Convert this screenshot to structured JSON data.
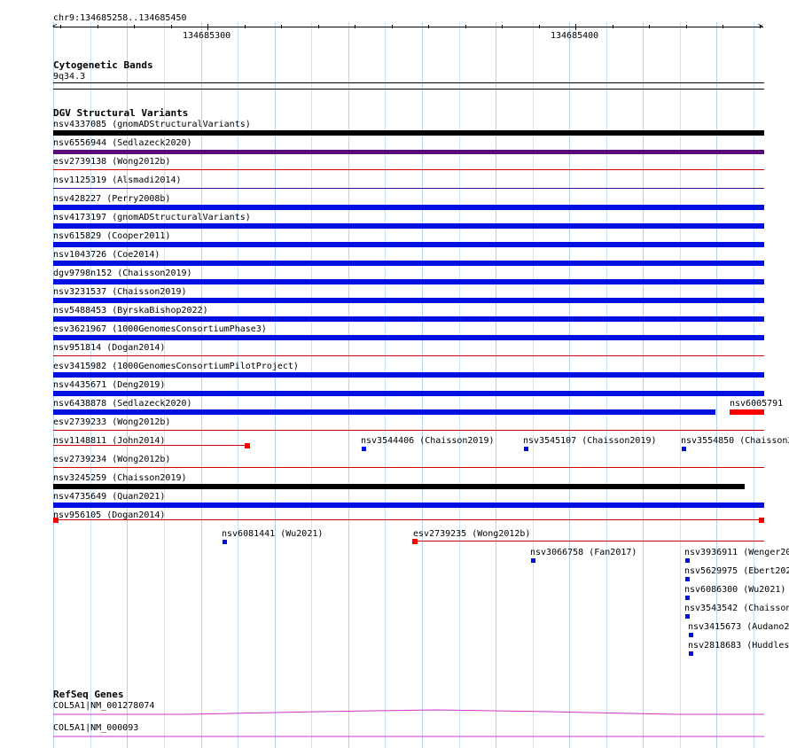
{
  "ruler": {
    "range_label": "chr9:134685258..134685450",
    "tick_labels": [
      "134685300",
      "134685400"
    ]
  },
  "cytoband": {
    "title": "Cytogenetic Bands",
    "band_label": "9q34.3"
  },
  "dgv": {
    "title": "DGV Structural Variants",
    "rows": [
      {
        "label": "nsv4337085 (gnomADStructuralVariants)",
        "color": "#000000",
        "kind": "thick"
      },
      {
        "label": "nsv6556944 (Sedlazeck2020)",
        "color": "#5a0a7a",
        "kind": "medium"
      },
      {
        "label": "esv2739138 (Wong2012b)",
        "color": "#d00000",
        "kind": "thin"
      },
      {
        "label": "nsv1125319 (Alsmadi2014)",
        "color": "#3a0a8a",
        "kind": "thin"
      },
      {
        "label": "nsv428227 (Perry2008b)",
        "color": "#0010e0",
        "kind": "thick"
      },
      {
        "label": "nsv4173197 (gnomADStructuralVariants)",
        "color": "#0010e0",
        "kind": "thick"
      },
      {
        "label": "nsv615829 (Cooper2011)",
        "color": "#0010e0",
        "kind": "thick"
      },
      {
        "label": "nsv1043726 (Coe2014)",
        "color": "#0010e0",
        "kind": "thick"
      },
      {
        "label": "dgv9798n152 (Chaisson2019)",
        "color": "#0010e0",
        "kind": "thick"
      },
      {
        "label": "nsv3231537 (Chaisson2019)",
        "color": "#0010e0",
        "kind": "thick"
      },
      {
        "label": "nsv5488453 (ByrskaBishop2022)",
        "color": "#0010e0",
        "kind": "thick"
      },
      {
        "label": "esv3621967 (1000GenomesConsortiumPhase3)",
        "color": "#0010e0",
        "kind": "thick"
      },
      {
        "label": "nsv951814 (Dogan2014)",
        "color": "#d00000",
        "kind": "thin"
      },
      {
        "label": "esv3415982 (1000GenomesConsortiumPilotProject)",
        "color": "#0010e0",
        "kind": "thick"
      },
      {
        "label": "nsv4435671 (Deng2019)",
        "color": "#0010e0",
        "kind": "thick"
      },
      {
        "label": "nsv6438878 (Sedlazeck2020)",
        "color": "#0010e0",
        "kind": "partial"
      },
      {
        "label": "esv2739233 (Wong2012b)",
        "color": "#d00000",
        "kind": "thin"
      },
      {
        "label": "nsv1148811 (John2014)",
        "color": "#d00000",
        "kind": "short-thin"
      },
      {
        "label": "esv2739234 (Wong2012b)",
        "color": "#d00000",
        "kind": "thin"
      },
      {
        "label": "nsv3245259 (Chaisson2019)",
        "color": "#000000",
        "kind": "thick-partial"
      },
      {
        "label": "nsv4735649 (Quan2021)",
        "color": "#0010e0",
        "kind": "thick"
      },
      {
        "label": "nsv956105 (Dogan2014)",
        "color": "#d00000",
        "kind": "thin-ends"
      }
    ],
    "side_label": "nsv6005791",
    "extra_features": [
      {
        "label": "nsv3544406 (Chaisson2019)",
        "color": "#0010e0"
      },
      {
        "label": "nsv3545107 (Chaisson2019)",
        "color": "#0010e0"
      },
      {
        "label": "nsv3554850 (Chaisson2",
        "color": "#0010e0"
      },
      {
        "label": "nsv6081441 (Wu2021)",
        "color": "#0010e0"
      },
      {
        "label": "esv2739235 (Wong2012b)",
        "color": "#d00000"
      },
      {
        "label": "nsv3066758 (Fan2017)",
        "color": "#0010e0"
      },
      {
        "label": "nsv3936911 (Wenger20",
        "color": "#0010e0"
      },
      {
        "label": "nsv5629975 (Ebert202",
        "color": "#0010e0"
      },
      {
        "label": "nsv6086300 (Wu2021)",
        "color": "#0010e0"
      },
      {
        "label": "nsv3543542 (Chaisson",
        "color": "#0010e0"
      },
      {
        "label": "nsv3415673 (Audano2",
        "color": "#0010e0"
      },
      {
        "label": "nsv2818683 (Huddles",
        "color": "#0010e0"
      }
    ]
  },
  "refseq": {
    "title": "RefSeq Genes",
    "transcripts": [
      {
        "label": "COL5A1|NM_001278074",
        "color": "#cc33cc"
      },
      {
        "label": "COL5A1|NM_000093",
        "color": "#cc33cc"
      }
    ]
  }
}
